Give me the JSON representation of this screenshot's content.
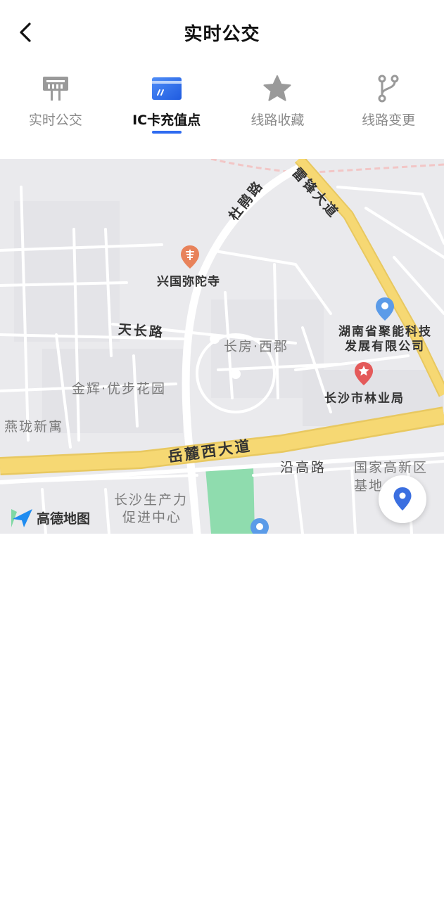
{
  "header": {
    "title": "实时公交",
    "back_icon": "chevron-left-icon"
  },
  "tabs": [
    {
      "label": "实时公交",
      "icon": "bus-stop-icon",
      "active": false
    },
    {
      "label": "IC卡充值点",
      "icon": "card-icon",
      "active": true
    },
    {
      "label": "线路收藏",
      "icon": "star-icon",
      "active": false
    },
    {
      "label": "线路变更",
      "icon": "route-branch-icon",
      "active": false
    }
  ],
  "colors": {
    "accent": "#2f6bf0",
    "inactive_tab": "#8a8a8a",
    "road_major": "#f6d873",
    "park": "#7fd8a4",
    "poi_red": "#e45a5a",
    "poi_blue": "#5b9be8",
    "temple": "#e8825a"
  },
  "map": {
    "roads": {
      "dupeng": "杜鹃路",
      "leifeng": "雷锋大道",
      "tianchang": "天长路",
      "yuelu_west": "岳麓西大道",
      "yangao": "沿高路"
    },
    "pois": {
      "temple": "兴国弥陀寺",
      "company_line1": "湖南省聚能科技",
      "company_line2": "发展有限公司",
      "forestry": "长沙市林业局",
      "changfang": "长房·西郡",
      "jinhui": "金辉·优步花园",
      "yanlong": "燕珑新寓",
      "productivity_line1": "长沙生产力",
      "productivity_line2": "促进中心",
      "national_line1": "国家高新区",
      "national_line2": "基地"
    },
    "logo_text": "高德地图",
    "locate_icon": "location-pin-icon"
  }
}
